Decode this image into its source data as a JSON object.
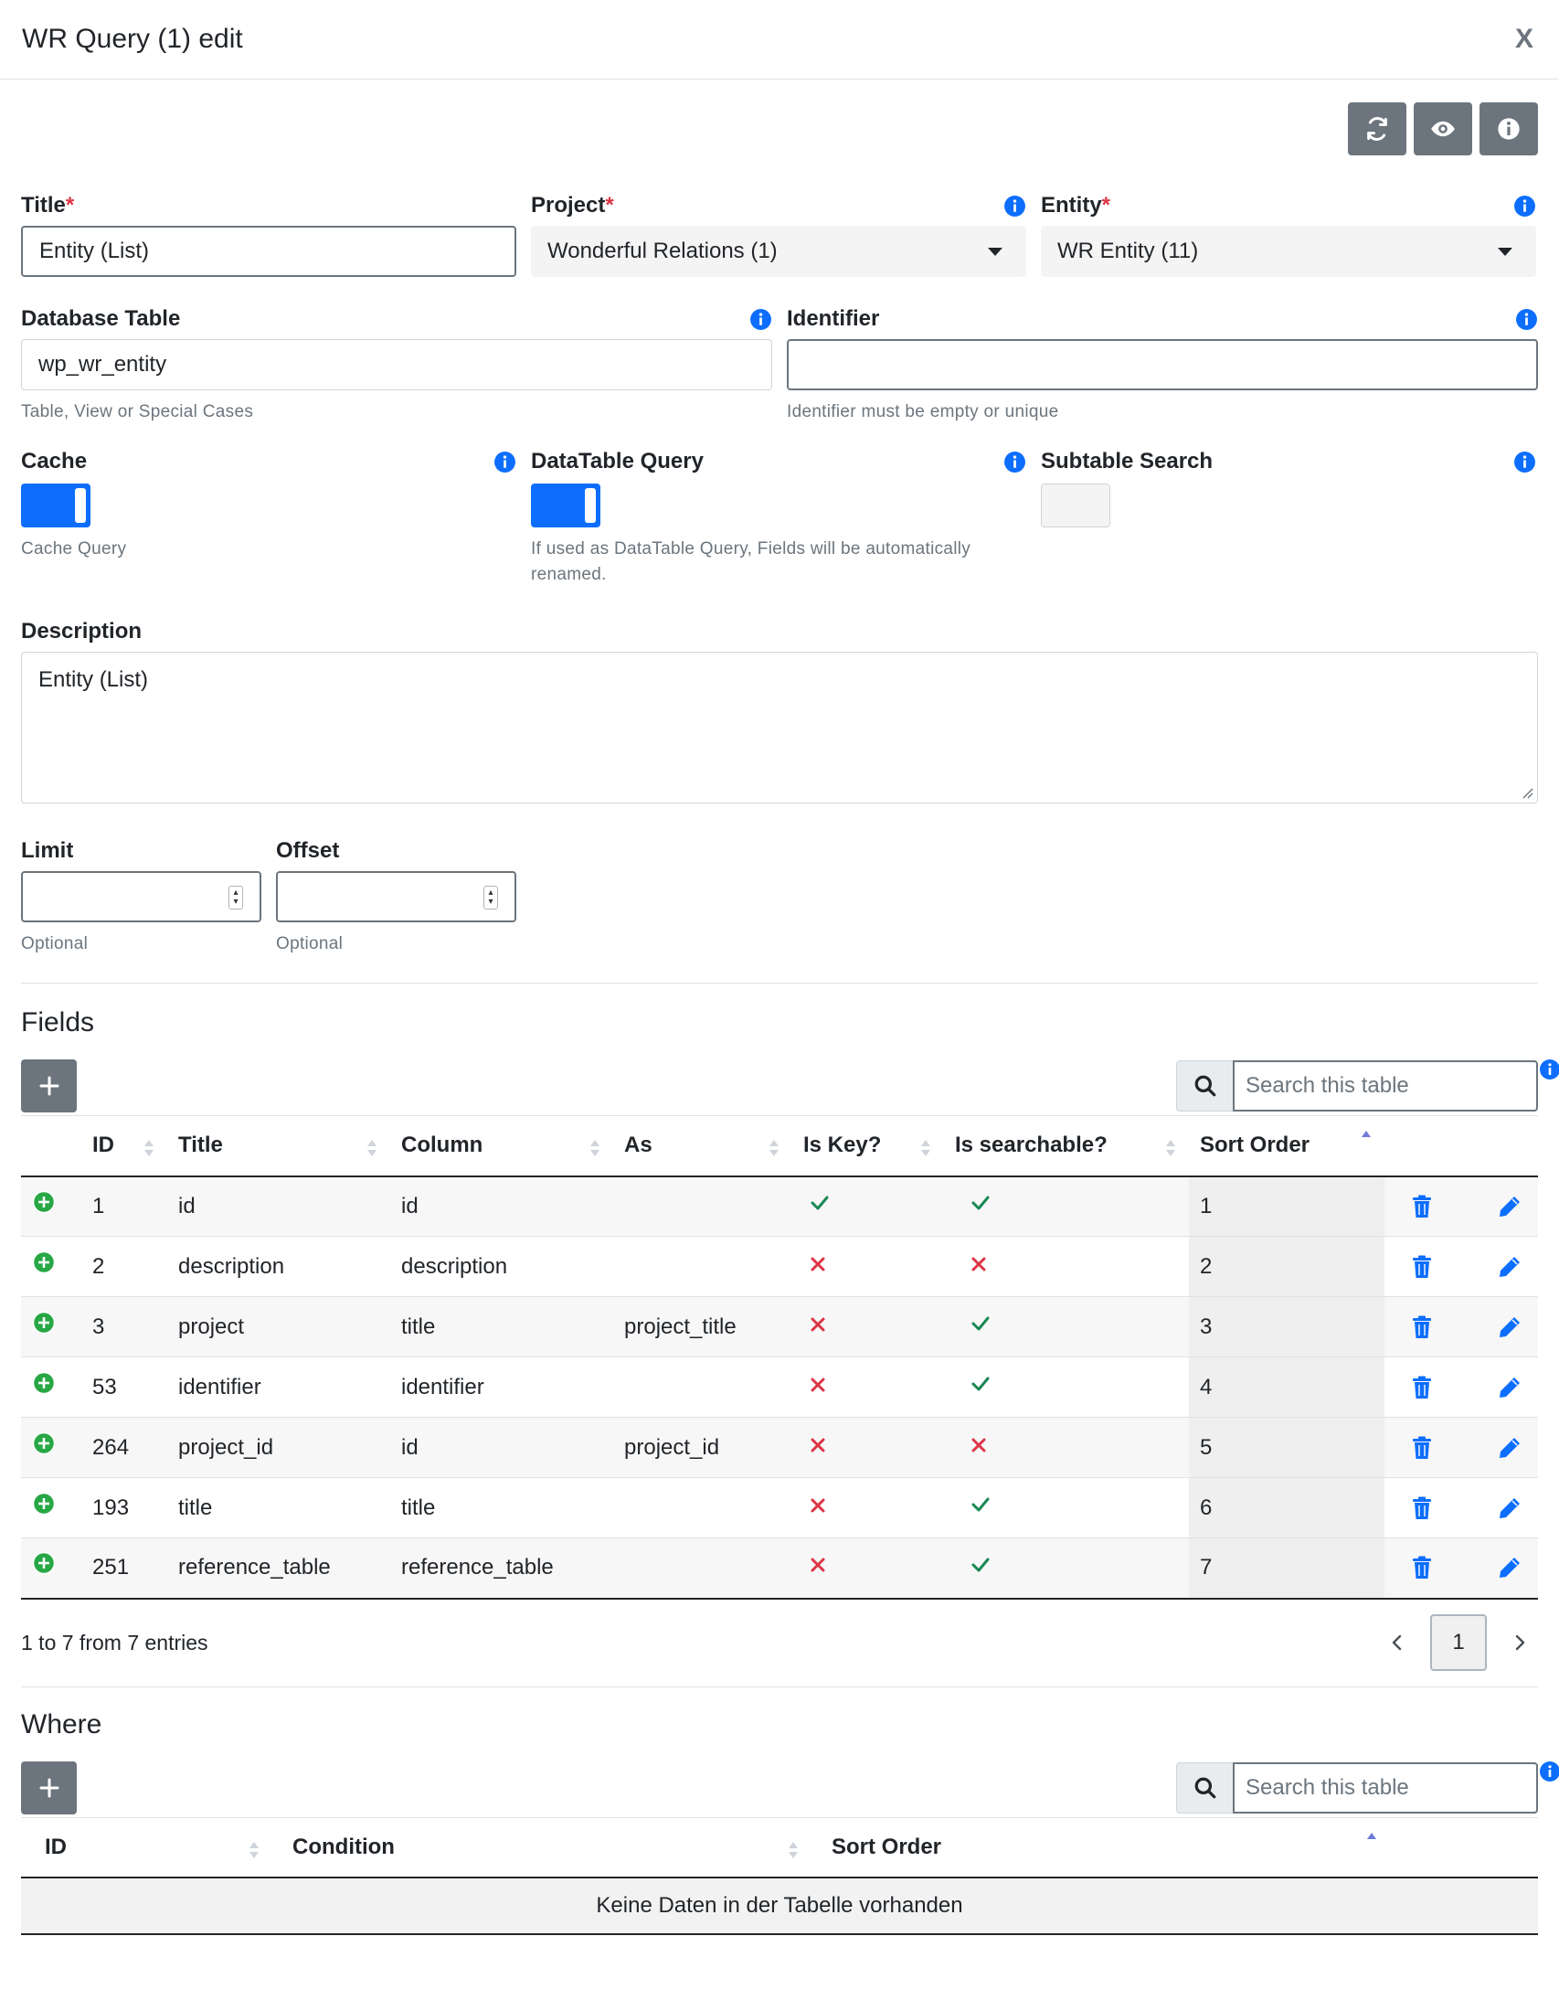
{
  "modal": {
    "title": "WR Query (1) edit",
    "close_label": "X"
  },
  "toolbar": {
    "refresh_icon": "refresh-icon",
    "preview_icon": "eye-icon",
    "info_icon": "info-icon"
  },
  "form": {
    "title": {
      "label": "Title",
      "required": "*",
      "value": "Entity (List)"
    },
    "project": {
      "label": "Project",
      "required": "*",
      "value": "Wonderful Relations (1)"
    },
    "entity": {
      "label": "Entity",
      "required": "*",
      "value": "WR Entity (11)"
    },
    "database_table": {
      "label": "Database Table",
      "value": "wp_wr_entity",
      "help": "Table, View or Special Cases"
    },
    "identifier": {
      "label": "Identifier",
      "value": "",
      "help": "Identifier must be empty or unique"
    },
    "cache": {
      "label": "Cache",
      "checked": true,
      "help": "Cache Query"
    },
    "datatable_query": {
      "label": "DataTable Query",
      "checked": true,
      "help": "If used as DataTable Query, Fields will be automatically renamed."
    },
    "subtable_search": {
      "label": "Subtable Search",
      "checked": false
    },
    "description": {
      "label": "Description",
      "value": "Entity (List)"
    },
    "limit": {
      "label": "Limit",
      "value": "",
      "help": "Optional"
    },
    "offset": {
      "label": "Offset",
      "value": "",
      "help": "Optional"
    }
  },
  "fields": {
    "title": "Fields",
    "search_placeholder": "Search this table",
    "columns": [
      "ID",
      "Title",
      "Column",
      "As",
      "Is Key?",
      "Is searchable?",
      "Sort Order"
    ],
    "rows": [
      {
        "id": "1",
        "title": "id",
        "column": "id",
        "as": "",
        "is_key": true,
        "searchable": true,
        "sort": "1"
      },
      {
        "id": "2",
        "title": "description",
        "column": "description",
        "as": "",
        "is_key": false,
        "searchable": false,
        "sort": "2"
      },
      {
        "id": "3",
        "title": "project",
        "column": "title",
        "as": "project_title",
        "is_key": false,
        "searchable": true,
        "sort": "3"
      },
      {
        "id": "53",
        "title": "identifier",
        "column": "identifier",
        "as": "",
        "is_key": false,
        "searchable": true,
        "sort": "4"
      },
      {
        "id": "264",
        "title": "project_id",
        "column": "id",
        "as": "project_id",
        "is_key": false,
        "searchable": false,
        "sort": "5"
      },
      {
        "id": "193",
        "title": "title",
        "column": "title",
        "as": "",
        "is_key": false,
        "searchable": true,
        "sort": "6"
      },
      {
        "id": "251",
        "title": "reference_table",
        "column": "reference_table",
        "as": "",
        "is_key": false,
        "searchable": true,
        "sort": "7"
      }
    ],
    "info": "1 to 7 from 7 entries",
    "current_page": "1"
  },
  "where": {
    "title": "Where",
    "search_placeholder": "Search this table",
    "columns": [
      "ID",
      "Condition",
      "Sort Order"
    ],
    "empty": "Keine Daten in der Tabelle vorhanden"
  },
  "colors": {
    "primary": "#0d6efd",
    "secondary": "#6c757d",
    "success": "#198754",
    "danger": "#dc3545"
  }
}
